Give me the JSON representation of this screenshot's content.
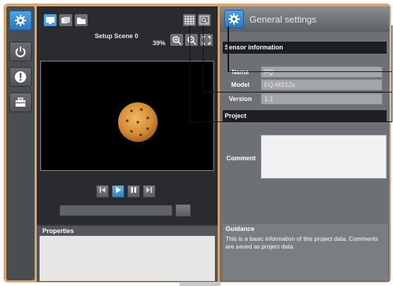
{
  "sidebar": {
    "items": [
      {
        "icon": "gear-icon",
        "active": true
      },
      {
        "icon": "power-icon",
        "active": false
      },
      {
        "icon": "alert-icon",
        "active": false
      },
      {
        "icon": "toolbox-icon",
        "active": false
      }
    ]
  },
  "viewer": {
    "scene_label": "Setup Scene 0",
    "zoom_label": "39%",
    "playback": [
      "step-back-icon",
      "play-icon",
      "pause-icon",
      "step-forward-icon"
    ]
  },
  "properties": {
    "header": "Properties"
  },
  "settings": {
    "title": "General settings",
    "sensor_section": "Sensor information",
    "name_label": "Name",
    "name_value": "FQ",
    "model_label": "Model",
    "model_value": "FQ-MS12x",
    "version_label": "Version",
    "version_value": "1.1",
    "project_section": "Project",
    "comment_label": "Comment",
    "comment_value": ""
  },
  "guidance": {
    "header": "Guidance",
    "text": "This is a basic information of this project data. Comments are saved as project data."
  },
  "colors": {
    "accent": "#2a78c4",
    "frame": "#d9a86a",
    "panel_dark": "#2a2b2e",
    "panel_gray": "#6d7075"
  }
}
